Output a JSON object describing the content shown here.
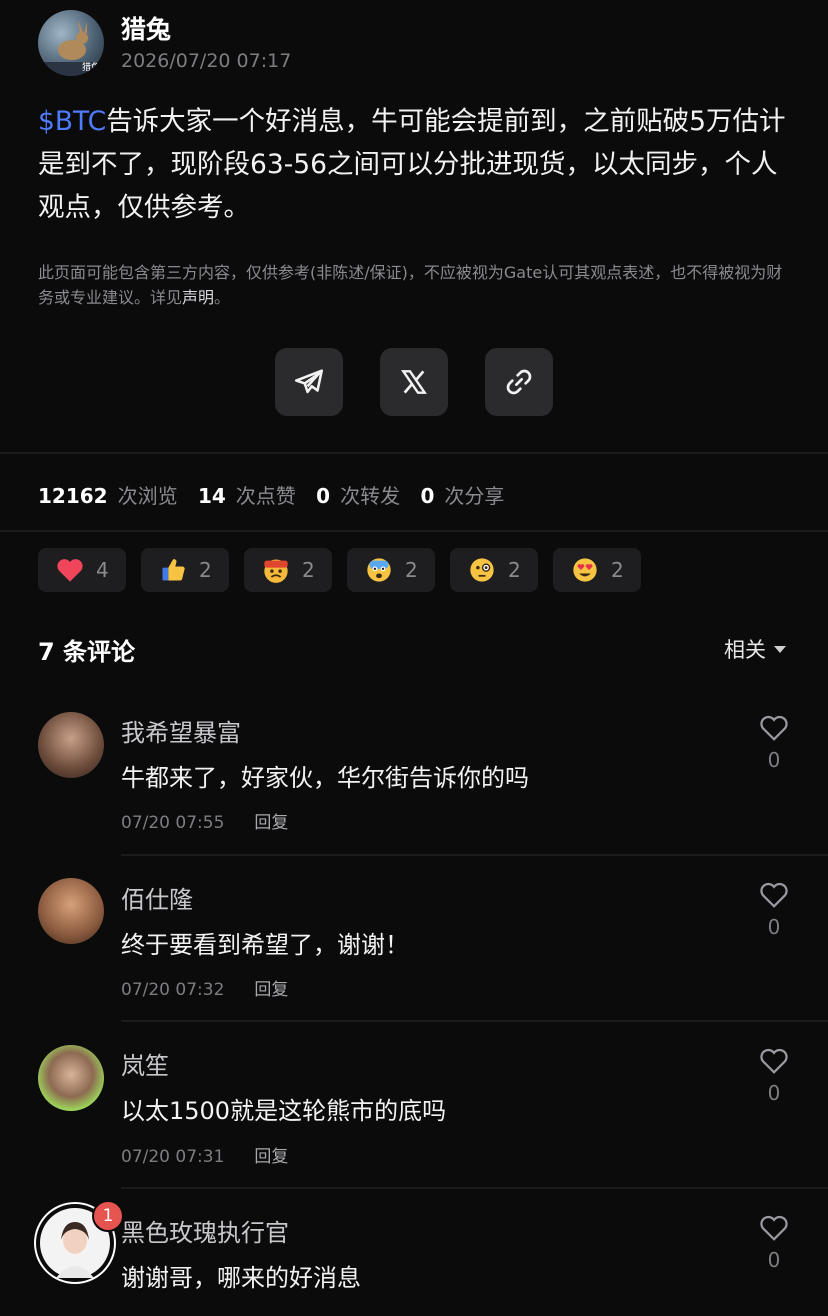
{
  "post": {
    "author": "猎兔",
    "time": "2026/07/20 07:17",
    "ticker": "$BTC",
    "body": "告诉大家一个好消息，牛可能会提前到，之前贴破5万估计是到不了，现阶段63-56之间可以分批进现货，以太同步，个人观点，仅供参考。",
    "avatar_badge_text": "猎兔"
  },
  "disclaimer": {
    "text": "此页面可能包含第三方内容，仅供参考(非陈述/保证)，不应被视为Gate认可其观点表述，也不得被视为财务或专业建议。详见",
    "link": "声明",
    "end": "。"
  },
  "share": {
    "telegram": "telegram-icon",
    "x": "x-logo-icon",
    "link": "link-icon"
  },
  "stats": {
    "views": "12162",
    "views_label": "次浏览",
    "likes": "14",
    "likes_label": "次点赞",
    "reposts": "0",
    "reposts_label": "次转发",
    "shares": "0",
    "shares_label": "次分享"
  },
  "reactions": [
    {
      "icon": "heart-icon",
      "count": "4"
    },
    {
      "icon": "thumbs-up-icon",
      "count": "2"
    },
    {
      "icon": "angry-face-icon",
      "count": "2"
    },
    {
      "icon": "scared-face-icon",
      "count": "2"
    },
    {
      "icon": "monocle-face-icon",
      "count": "2"
    },
    {
      "icon": "heart-eyes-icon",
      "count": "2"
    }
  ],
  "comments_header": {
    "title": "7 条评论",
    "sort": "相关"
  },
  "comments": [
    {
      "name": "我希望暴富",
      "text": "牛都来了，好家伙，华尔街告诉你的吗",
      "time": "07/20 07:55",
      "reply": "回复",
      "likes": "0"
    },
    {
      "name": "佰仕隆",
      "text": "终于要看到希望了，谢谢！",
      "time": "07/20 07:32",
      "reply": "回复",
      "likes": "0"
    },
    {
      "name": "岚笙",
      "text": "以太1500就是这轮熊市的底吗",
      "time": "07/20 07:31",
      "reply": "回复",
      "likes": "0"
    },
    {
      "name": "黑色玫瑰执行官",
      "text": "谢谢哥，哪来的好消息",
      "time": "",
      "reply": "",
      "likes": "0",
      "badge": "1"
    }
  ],
  "colors": {
    "background": "#0b0b0c",
    "accent_link": "#4f7bff",
    "badge": "#e5544e"
  }
}
